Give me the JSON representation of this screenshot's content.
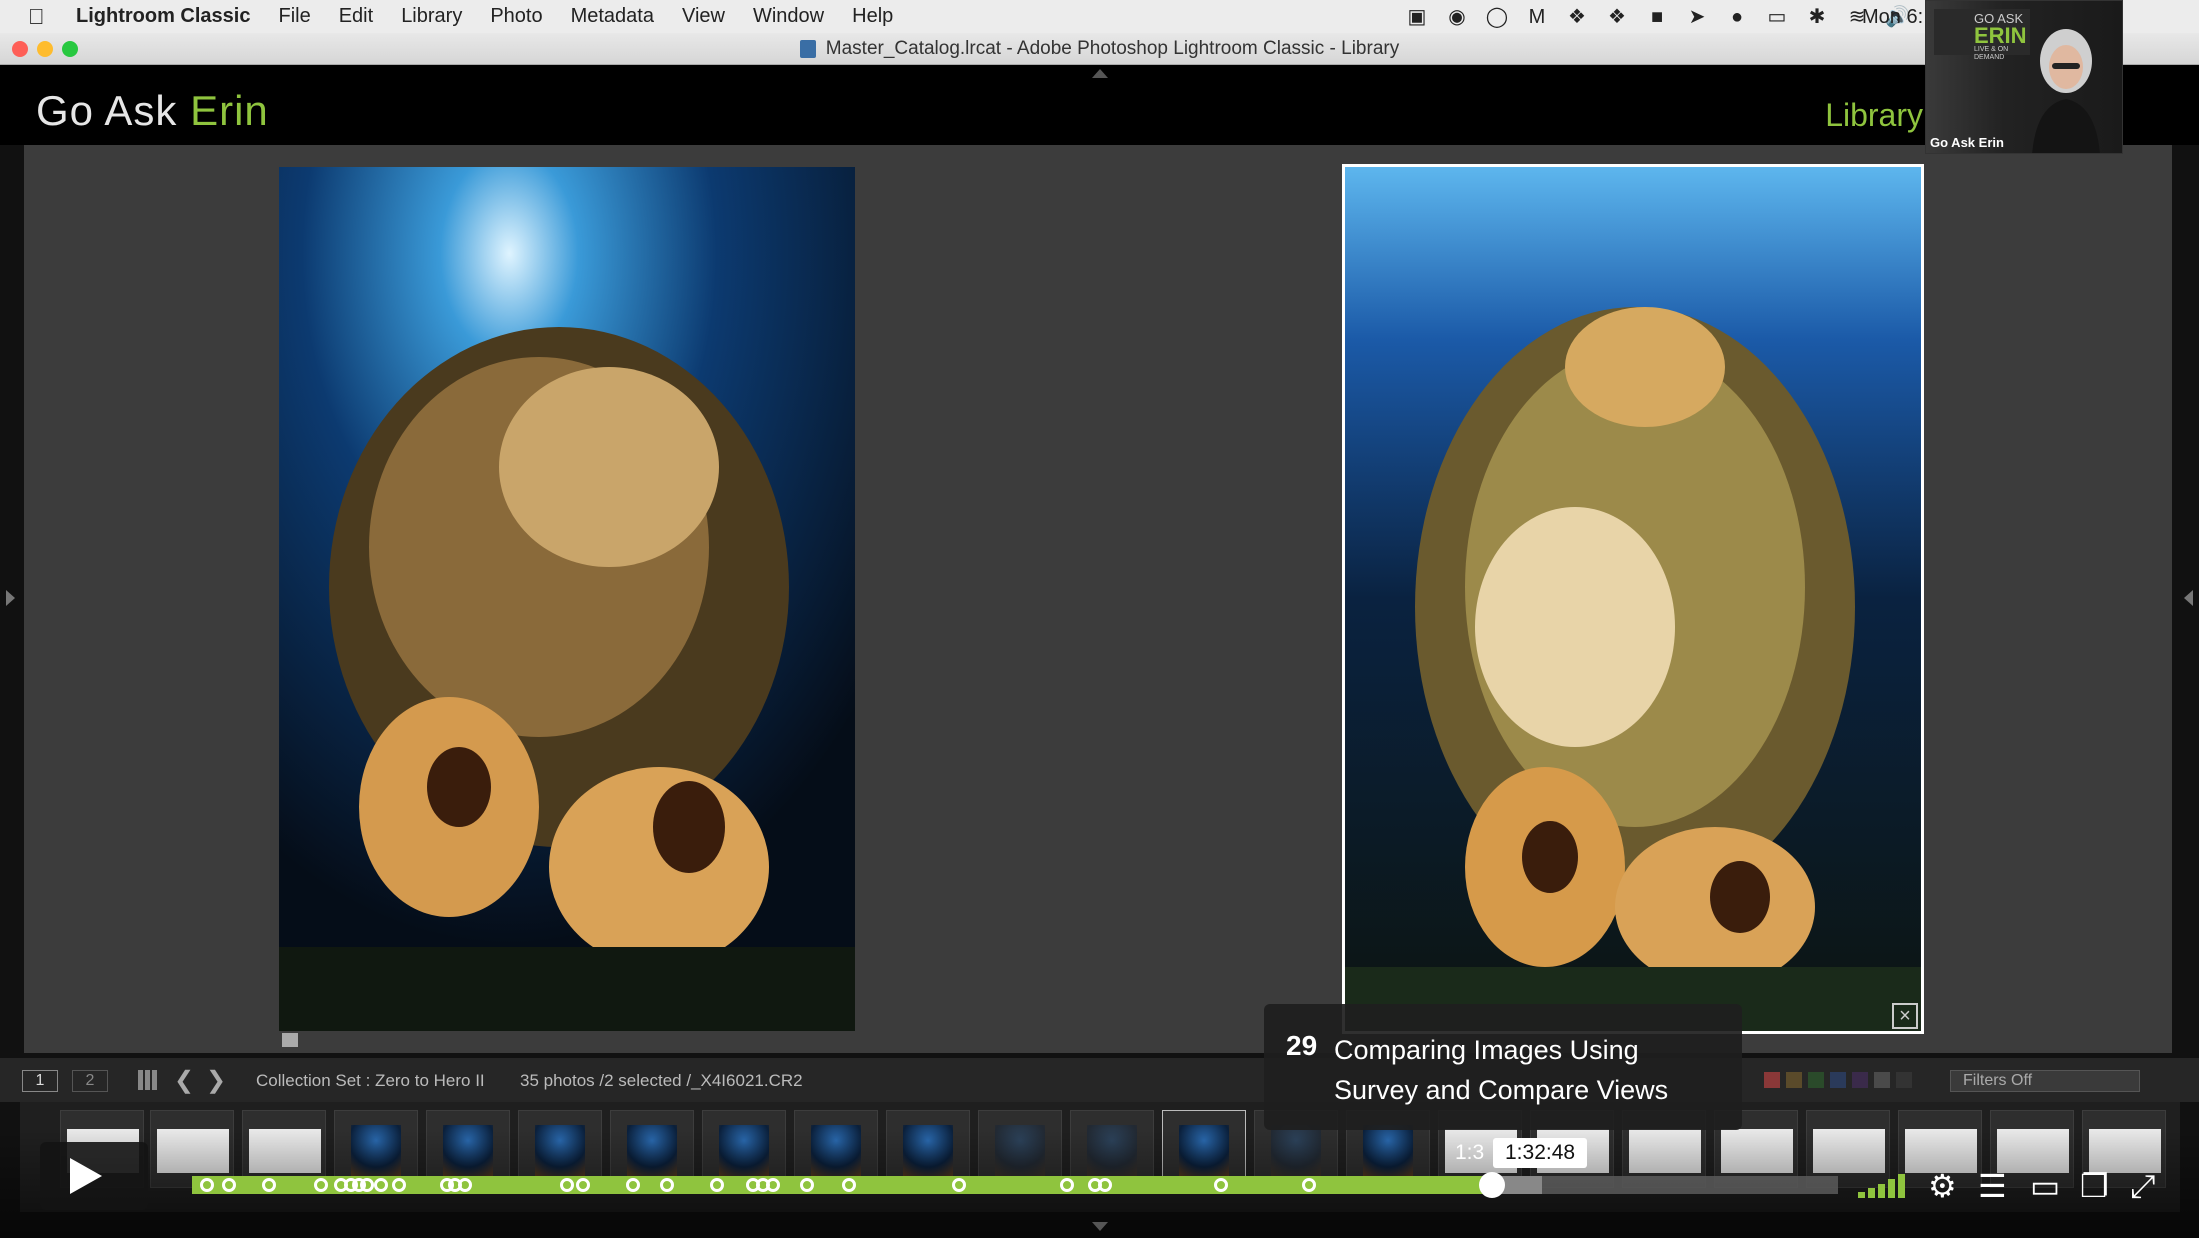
{
  "menubar": {
    "app_name": "Lightroom Classic",
    "items": [
      "File",
      "Edit",
      "Library",
      "Photo",
      "Metadata",
      "View",
      "Window",
      "Help"
    ],
    "clock": "Mon 6:"
  },
  "window": {
    "title": "Master_Catalog.lrcat - Adobe Photoshop Lightroom Classic - Library"
  },
  "header": {
    "brand_part1": "Go Ask ",
    "brand_part2": "Erin",
    "module": "Library",
    "accent_color": "#8fc43e"
  },
  "filmstrip_toolbar": {
    "monitor1": "1",
    "monitor2": "2",
    "source": "Collection Set : Zero to Hero II",
    "count": "35 photos /2 selected /_X4I6021.CR2",
    "filter": "Filters Off"
  },
  "video": {
    "chapter_number": "29",
    "chapter_title": "Comparing Images Using Survey and Compare Views",
    "hover_time": "1:32:48",
    "hover_time_prefix": "1:3",
    "progress_fraction": 0.79,
    "buffered_fraction": 0.82
  },
  "webcam": {
    "logo_top": "GO ASK",
    "logo_main": "ERIN",
    "logo_sub": "LIVE & ON DEMAND",
    "name": "Go Ask Erin"
  }
}
